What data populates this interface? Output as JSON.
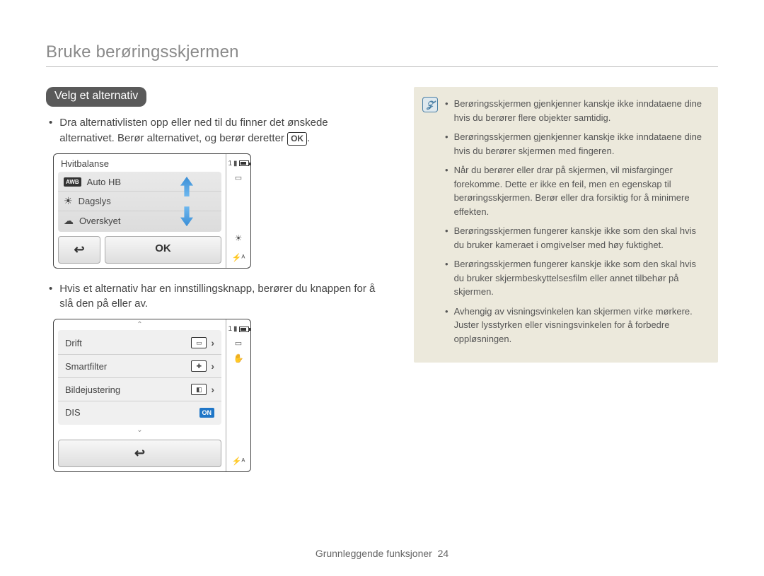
{
  "page": {
    "title": "Bruke berøringsskjermen",
    "footer_label": "Grunnleggende funksjoner",
    "footer_page": "24"
  },
  "section": {
    "heading": "Velg et alternativ",
    "intro_text": "Dra alternativlisten opp eller ned til du finner det ønskede alternativet. Berør alternativet, og berør deretter ",
    "intro_ok": "OK",
    "intro_period": ".",
    "toggle_text": "Hvis et alternativ har en innstillingsknapp, berører du knappen for å slå den på eller av."
  },
  "device1": {
    "header": "Hvitbalanse",
    "items": [
      "Auto HB",
      "Dagslys",
      "Overskyet"
    ],
    "back_glyph": "↩",
    "ok_label": "OK",
    "side": {
      "count": "1",
      "flash": "⚡ᴬ",
      "brightness": "☀"
    }
  },
  "device2": {
    "rows": [
      {
        "label": "Drift"
      },
      {
        "label": "Smartfilter"
      },
      {
        "label": "Bildejustering"
      },
      {
        "label": "DIS",
        "on": "ON"
      }
    ],
    "back_glyph": "↩",
    "side": {
      "count": "1",
      "flash": "⚡ᴬ",
      "hand": "✋"
    }
  },
  "notes": {
    "items": [
      "Berøringsskjermen gjenkjenner kanskje ikke inndataene dine hvis du berører flere objekter samtidig.",
      "Berøringsskjermen gjenkjenner kanskje ikke inndataene dine hvis du berører skjermen med fingeren.",
      "Når du berører eller drar på skjermen, vil misfarginger forekomme. Dette er ikke en feil, men en egenskap til berøringsskjermen. Berør eller dra forsiktig for å minimere effekten.",
      "Berøringsskjermen fungerer kanskje ikke som den skal hvis du bruker kameraet i omgivelser med høy fuktighet.",
      "Berøringsskjermen fungerer kanskje ikke som den skal hvis du bruker skjermbeskyttelsesfilm eller annet tilbehør på skjermen.",
      "Avhengig av visningsvinkelen kan skjermen virke mørkere. Juster lysstyrken eller visningsvinkelen for å forbedre oppløsningen."
    ]
  }
}
